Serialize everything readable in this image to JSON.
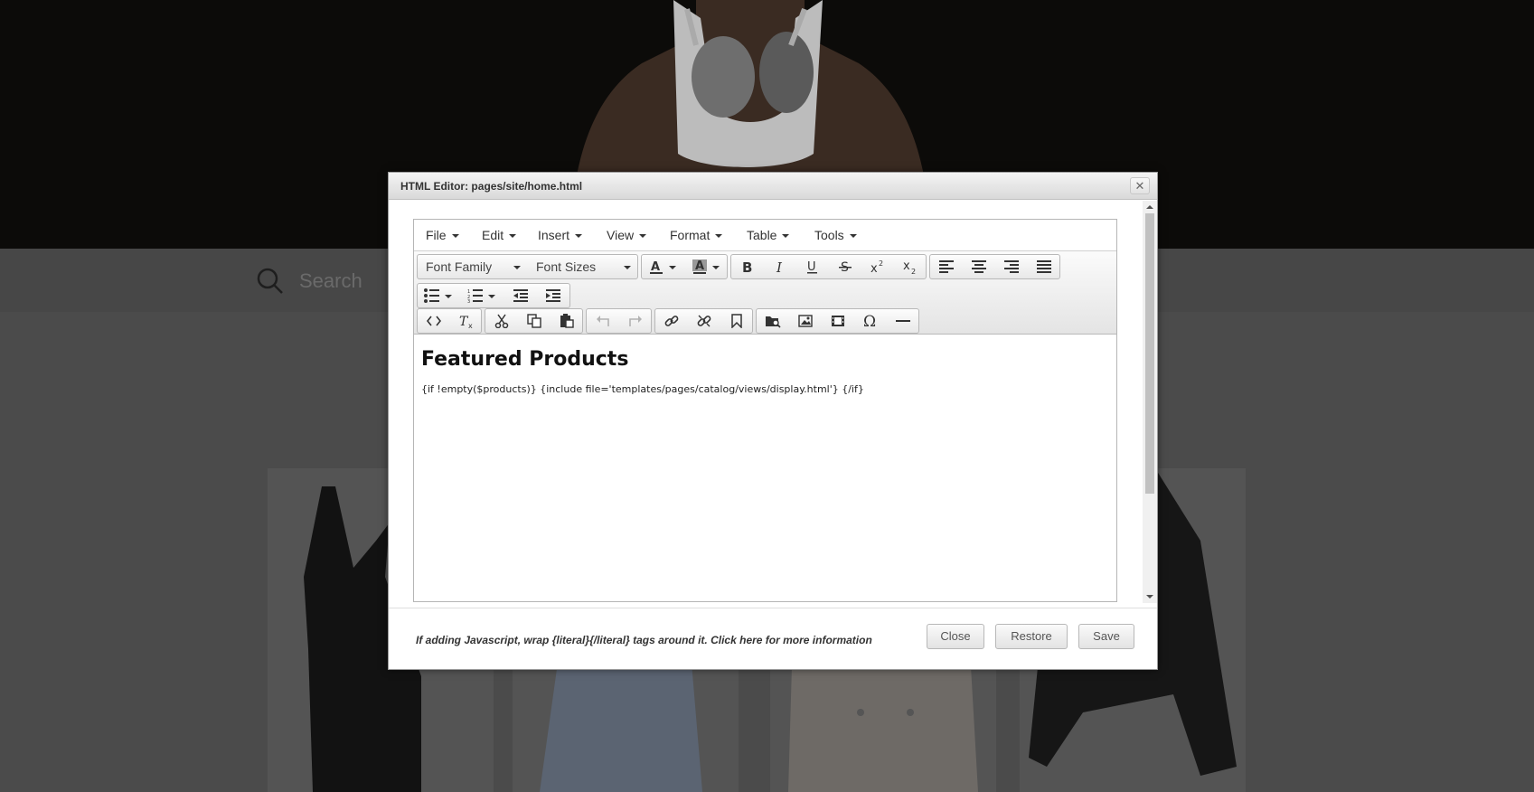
{
  "background": {
    "search_placeholder": "Search"
  },
  "modal": {
    "title": "HTML Editor: pages/site/home.html",
    "close_glyph": "✕",
    "menu": [
      "File",
      "Edit",
      "Insert",
      "View",
      "Format",
      "Table",
      "Tools"
    ],
    "font_family_label": "Font Family",
    "font_sizes_label": "Font Sizes",
    "content": {
      "heading": "Featured Products",
      "code": "{if !empty($products)} {include file='templates/pages/catalog/views/display.html'} {/if}"
    },
    "footer": {
      "note": "If adding Javascript, wrap {literal}{/literal} tags around it. Click here for more information",
      "close_label": "Close",
      "restore_label": "Restore",
      "save_label": "Save"
    }
  }
}
